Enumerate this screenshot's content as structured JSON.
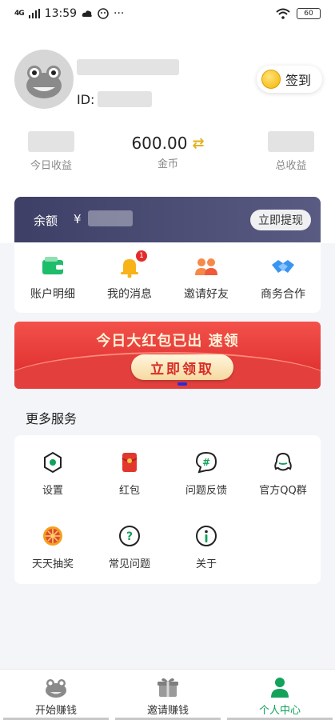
{
  "status_bar": {
    "network": "4G",
    "time": "13:59",
    "extra": "···",
    "battery": "60"
  },
  "profile": {
    "id_label": "ID:",
    "signin_label": "签到"
  },
  "stats": {
    "left_label": "今日收益",
    "mid_value": "600.00",
    "mid_label": "金币",
    "right_label": "总收益"
  },
  "balance": {
    "label": "余额",
    "currency": "¥",
    "withdraw_label": "立即提现"
  },
  "quick_actions": [
    {
      "label": "账户明细",
      "icon": "wallet-icon"
    },
    {
      "label": "我的消息",
      "icon": "bell-icon",
      "badge": "1"
    },
    {
      "label": "邀请好友",
      "icon": "people-icon"
    },
    {
      "label": "商务合作",
      "icon": "handshake-icon"
    }
  ],
  "banner": {
    "title": "今日大红包已出 速领",
    "button_label": "立即领取"
  },
  "more_services": {
    "title": "更多服务",
    "items": [
      {
        "label": "设置",
        "icon": "settings-icon"
      },
      {
        "label": "红包",
        "icon": "red-packet-icon"
      },
      {
        "label": "问题反馈",
        "icon": "feedback-icon"
      },
      {
        "label": "官方QQ群",
        "icon": "qq-icon"
      },
      {
        "label": "天天抽奖",
        "icon": "lottery-wheel-icon"
      },
      {
        "label": "常见问题",
        "icon": "question-icon"
      },
      {
        "label": "关于",
        "icon": "info-icon"
      }
    ]
  },
  "bottom_nav": [
    {
      "label": "开始赚钱",
      "icon": "frog-icon"
    },
    {
      "label": "邀请赚钱",
      "icon": "gift-icon"
    },
    {
      "label": "个人中心",
      "icon": "person-icon",
      "active": true
    }
  ],
  "colors": {
    "accent": "#12a25b",
    "banner_red": "#d9282a",
    "card_dark": "#3d3f66"
  }
}
